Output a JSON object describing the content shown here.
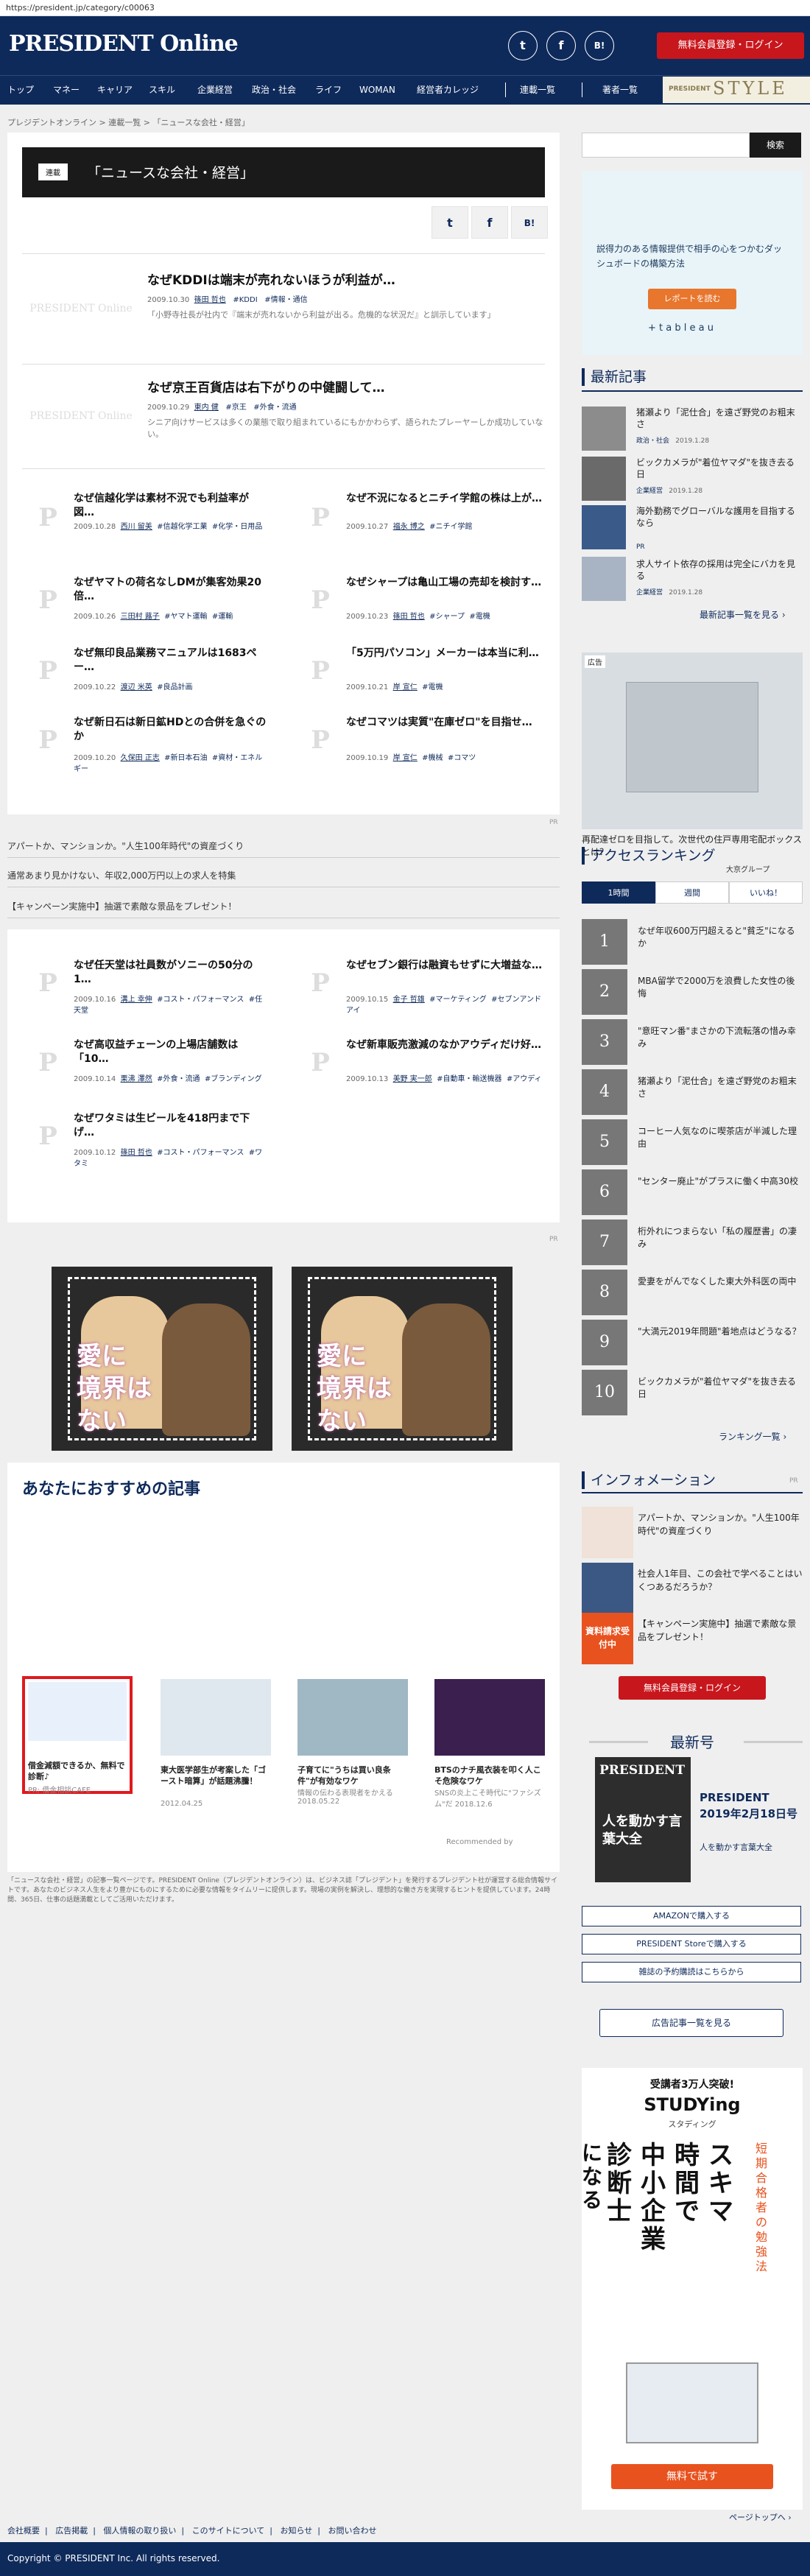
{
  "url": "https://president.jp/category/c00063",
  "header": {
    "logo": "PRESIDENT Online",
    "social": [
      "t",
      "f",
      "B!"
    ],
    "register_button": "無料会員登録・ログイン"
  },
  "nav": {
    "items": [
      "トップ",
      "マネー",
      "キャリア",
      "スキル",
      "企業経営",
      "政治・社会",
      "ライフ",
      "WOMAN",
      "経営者カレッジ",
      "連載一覧",
      "著者一覧"
    ],
    "style_brand": "PRESIDENT",
    "style_word": "STYLE"
  },
  "breadcrumb": [
    "プレジデントオンライン",
    "連載一覧",
    "「ニュースな会社・経営」"
  ],
  "category": {
    "tag": "連載",
    "title": "「ニュースな会社・経営」"
  },
  "share": [
    "t",
    "f",
    "B!"
  ],
  "big_articles": [
    {
      "thumb": "PRESIDENT Online",
      "title": "なぜKDDIは端末が売れないほうが利益が…",
      "date": "2009.10.30",
      "author": "篠田 哲也",
      "tags": [
        "#KDDI",
        "#情報・通信"
      ],
      "excerpt": "「小野寺社長が社内で『端末が売れないから利益が出る。危機的な状況だ』と訓示しています」"
    },
    {
      "thumb": "PRESIDENT Online",
      "title": "なぜ京王百貨店は右下がりの中健闘して…",
      "date": "2009.10.29",
      "author": "東内 健",
      "tags": [
        "#京王",
        "#外食・流通"
      ],
      "excerpt": "シニア向けサービスは多くの業態で取り組まれているにもかかわらず、語られたプレーヤーしか成功していない。"
    }
  ],
  "grid_articles": [
    {
      "title": "なぜ信越化学は素材不況でも利益率が図…",
      "date": "2009.10.28",
      "author": "西川 留美",
      "tags": [
        "#信越化学工業",
        "#化学・日用品"
      ]
    },
    {
      "title": "なぜ不況になるとニチイ学館の株は上が…",
      "date": "2009.10.27",
      "author": "福永 博之",
      "tags": [
        "#ニチイ学館"
      ]
    },
    {
      "title": "なぜヤマトの荷名なしDMが集客効果20倍…",
      "date": "2009.10.26",
      "author": "三田村 蕗子",
      "tags": [
        "#ヤマト運輸",
        "#運輸"
      ]
    },
    {
      "title": "なぜシャープは亀山工場の売却を検討す…",
      "date": "2009.10.23",
      "author": "篠田 哲也",
      "tags": [
        "#シャープ",
        "#電機"
      ]
    },
    {
      "title": "なぜ無印良品業務マニュアルは1683ペー…",
      "date": "2009.10.22",
      "author": "渡辺 米英",
      "tags": [
        "#良品計画"
      ]
    },
    {
      "title": "「5万円パソコン」メーカーは本当に利…",
      "date": "2009.10.21",
      "author": "岸 宣仁",
      "tags": [
        "#電機"
      ]
    },
    {
      "title": "なぜ新日石は新日鉱HDとの合併を急ぐのか",
      "date": "2009.10.20",
      "author": "久保田 正志",
      "tags": [
        "#新日本石油",
        "#資材・エネルギー"
      ]
    },
    {
      "title": "なぜコマツは実質\"在庫ゼロ\"を目指せ…",
      "date": "2009.10.19",
      "author": "岸 宣仁",
      "tags": [
        "#機械",
        "#コマツ"
      ]
    }
  ],
  "grid_articles_2": [
    {
      "title": "なぜ任天堂は社員数がソニーの50分の1…",
      "date": "2009.10.16",
      "author": "溝上 幸伸",
      "tags": [
        "#コスト・パフォーマンス",
        "#任天堂"
      ]
    },
    {
      "title": "なぜセブン銀行は融資もせずに大増益な…",
      "date": "2009.10.15",
      "author": "金子 哲雄",
      "tags": [
        "#マーケティング",
        "#セブンアンドアイ"
      ]
    },
    {
      "title": "なぜ高収益チェーンの上場店舗数は「10…",
      "date": "2009.10.14",
      "author": "栗沸 澤然",
      "tags": [
        "#外食・流通",
        "#ブランディング"
      ]
    },
    {
      "title": "なぜ新車販売激減のなかアウディだけ好…",
      "date": "2009.10.13",
      "author": "美野 実一郎",
      "tags": [
        "#自動車・輸送機器",
        "#アウディ"
      ]
    },
    {
      "title": "なぜワタミは生ビールを418円まで下げ…",
      "date": "2009.10.12",
      "author": "篠田 哲也",
      "tags": [
        "#コスト・パフォーマンス",
        "#ワタミ"
      ]
    }
  ],
  "pr_label": "PR",
  "pr_links": [
    "アパートか、マンションか。\"人生100年時代\"の資産づくり",
    "通常あまり見かけない、年収2,000万円以上の求人を特集",
    "【キャンペーン実施中】抽選で素敵な景品をプレゼント！"
  ],
  "banner_text": [
    "愛に",
    "境界は",
    "ない"
  ],
  "recommend": {
    "title": "あなたにおすすめの記事",
    "items": [
      {
        "title": "借金減額できるか、無料で診断♪",
        "sub": "PR: 借金相談CAFE",
        "highlight": true
      },
      {
        "title": "東大医学部生が考案した「ゴースト暗算」が話題沸騰！",
        "sub": "2012.04.25",
        "highlight": false
      },
      {
        "title": "子育てに\"うちは買い良条件\"が有効なワケ",
        "sub": "情報の伝わる表現者をかえる 2018.05.22",
        "highlight": false
      },
      {
        "title": "BTSのナチ風衣装を叩く人こそ危険なワケ",
        "sub": "SNSの炎上こそ時代に\"ファシズム\"だ 2018.12.6",
        "highlight": false
      }
    ],
    "recommended_by": "Recommended by"
  },
  "description": "「ニュースな会社・経営」の記事一覧ページです。PRESIDENT Online（プレジデントオンライン）は、ビジネス誌「プレジデント」を発行するプレジデント社が運営する総合情報サイトです。あなたのビジネス人生をより豊かにものにするために必要な情報をタイムリーに提供します。現場の実例を解決し、理想的な働き方を実現するヒントを提供しています。24時間、365日、仕事の話題満載としてご活用いただけます。",
  "sidebar": {
    "search_label": "検索",
    "tableau_ad": {
      "headline": "説得力のある情報提供で相手の心をつかむダッシュボードの構築方法",
      "cta": "レポートを読む",
      "brand": "+ t a b l e a u"
    },
    "latest_title": "最新記事",
    "latest": [
      {
        "title": "猪瀬より「泥仕合」を遠ざ野党のお粗末さ",
        "cat": "政治・社会",
        "date": "2019.1.28"
      },
      {
        "title": "ビックカメラが\"着位ヤマダ\"を抜き去る日",
        "cat": "企業経営",
        "date": "2019.1.28"
      },
      {
        "title": "海外勤務でグローバルな護用を目指するなら",
        "cat": "PR",
        "date": ""
      },
      {
        "title": "求人サイト依存の採用は完全にバカを見る",
        "cat": "企業経営",
        "date": "2019.1.28"
      }
    ],
    "latest_more": "最新記事一覧を見る",
    "ad_label": "広告",
    "ad_caption": "再配達ゼロを目指して。次世代の住戸専用宅配ボックスとは？",
    "ad_source": "大京グループ",
    "ranking_title": "アクセスランキング",
    "ranking_tabs": [
      "1時間",
      "週間",
      "いいね！"
    ],
    "ranking": [
      "なぜ年収600万円超えると\"貧乏\"になるか",
      "MBA留学で2000万を浪費した女性の後悔",
      "\"意旺マン番\"まさかの下流転落の惜み幸み",
      "猪瀬より「泥仕合」を遠ざ野党のお粗末さ",
      "コーヒー人気なのに喫茶店が半減した理由",
      "\"センター廃止\"がプラスに働く中高30校",
      "桁外れにつまらない「私の履歴書」の凄み",
      "愛妻をがんでなくした東大外科医の両中",
      "\"大満元2019年問題\"着地点はどうなる？",
      "ビックカメラが\"着位ヤマダ\"を抜き去る日"
    ],
    "ranking_more": "ランキング一覧",
    "info_title": "インフォメーション",
    "info": [
      "アパートか、マンションか。\"人生100年時代\"の資産づくり",
      "社会人1年目、この会社で学べることはいくつあるだろうか？",
      "【キャンペーン実施中】抽選で素敵な景品をプレゼント！"
    ],
    "info_badge": "資料請求受付中",
    "register_button": "無料会員登録・ログイン",
    "latest_issue_title": "最新号",
    "magazine": {
      "cover_title": "PRESIDENT",
      "cover_headline": "人を動かす言葉大全",
      "name": "PRESIDENT 2019年2月18日号",
      "sub": "人を動かす言葉大全"
    },
    "buttons": [
      "AMAZONで購入する",
      "PRESIDENT Storeで購入する",
      "雑誌の予約購読はこちらから"
    ],
    "ad_list_button": "広告記事一覧を見る",
    "studying": {
      "top": "受講者3万人突破!",
      "logo": "STUDYing",
      "sub": "スタディング",
      "big": [
        "スキマ",
        "時間で",
        "中小企業",
        "診断士"
      ],
      "verb": "になる",
      "side": "短期合格者の勉強法",
      "cta": "無料で試す"
    }
  },
  "pagetop": "ページトップへ",
  "footer": {
    "links": [
      "会社概要",
      "広告掲載",
      "個人情報の取り扱い",
      "このサイトについて",
      "お知らせ",
      "お問い合わせ"
    ],
    "copyright": "Copyright © PRESIDENT Inc. All rights reserved."
  },
  "colors": {
    "navy": "#0e2a5b",
    "red": "#c8161d"
  }
}
